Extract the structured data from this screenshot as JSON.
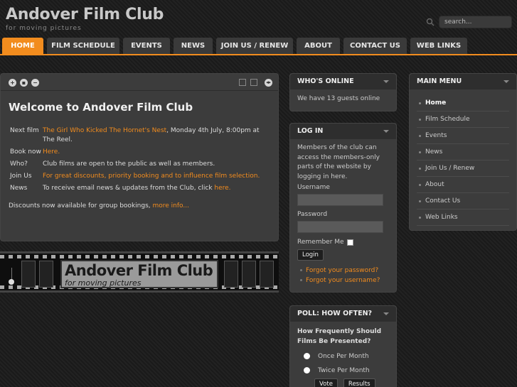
{
  "header": {
    "site_title": "Andover Film Club",
    "tagline": "for moving pictures",
    "search_placeholder": "search..."
  },
  "nav": {
    "tabs": [
      {
        "label": "HOME",
        "active": true
      },
      {
        "label": "FILM SCHEDULE",
        "active": false
      },
      {
        "label": "EVENTS",
        "active": false
      },
      {
        "label": "NEWS",
        "active": false
      },
      {
        "label": "JOIN US / RENEW",
        "active": false
      },
      {
        "label": "ABOUT",
        "active": false
      },
      {
        "label": "CONTACT US",
        "active": false
      },
      {
        "label": "WEB LINKS",
        "active": false
      }
    ]
  },
  "main": {
    "title": "Welcome to Andover Film Club",
    "rows": [
      {
        "label": "Next film",
        "link": "The Girl Who Kicked The Hornet's Nest",
        "text": ", Monday 4th July, 8:00pm at The Reel."
      },
      {
        "label": "Book now",
        "link": "Here.",
        "text": ""
      },
      {
        "label": "Who?",
        "link": "",
        "text": "Club films are open to the public as well as members."
      },
      {
        "label": "Join Us",
        "link": "For great discounts, priority booking and to influence film selection.",
        "text": ""
      },
      {
        "label": "News",
        "text": "To receive email news & updates from the Club, click ",
        "link": "here."
      }
    ],
    "discounts_text": "Discounts now available for group bookings, ",
    "discounts_link": "more info..."
  },
  "banner": {
    "title": "Andover Film Club",
    "subtitle": "for moving pictures"
  },
  "whos_online": {
    "heading": "WHO'S ONLINE",
    "text": "We have 13 guests online"
  },
  "login": {
    "heading": "LOG IN",
    "intro": "Members of the club can access the members-only parts of the website by logging in here.",
    "username_label": "Username",
    "password_label": "Password",
    "remember_label": "Remember Me",
    "button": "Login",
    "forgot_password": "Forgot your password?",
    "forgot_username": "Forgot your username?"
  },
  "poll": {
    "heading": "POLL: HOW OFTEN?",
    "question": "How Frequently Should Films Be Presented?",
    "options": [
      "Once Per Month",
      "Twice Per Month"
    ],
    "vote_button": "Vote",
    "results_button": "Results"
  },
  "main_menu": {
    "heading": "MAIN MENU",
    "items": [
      "Home",
      "Film Schedule",
      "Events",
      "News",
      "Join Us / Renew",
      "About",
      "Contact Us",
      "Web Links"
    ]
  },
  "colors": {
    "accent": "#f28c1e",
    "background": "#1c1c1c",
    "panel": "#3c3c3c"
  }
}
